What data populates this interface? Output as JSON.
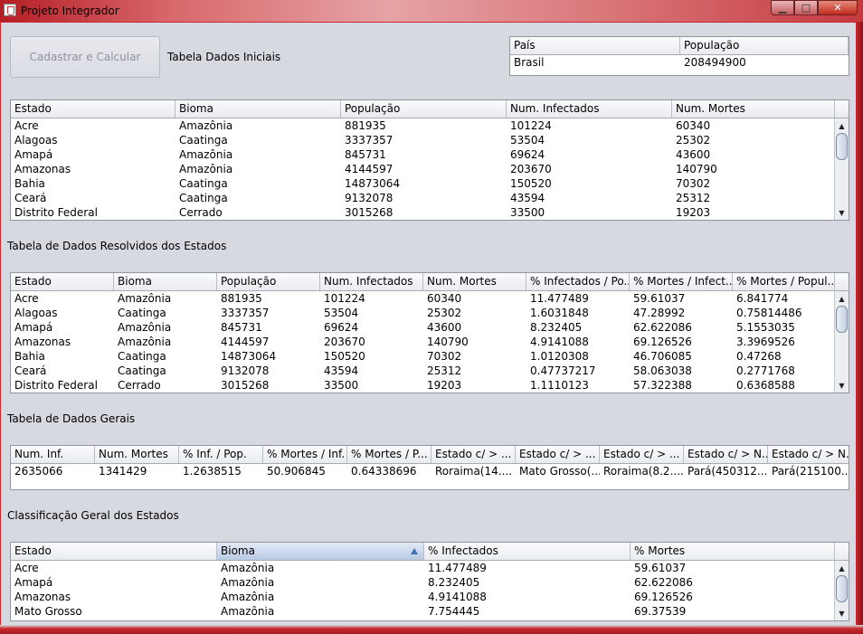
{
  "window": {
    "title": "Projeto Integrador",
    "minimize": "▁",
    "maximize": "□",
    "close": "✕"
  },
  "toolbar": {
    "cadastrar_label": "Cadastrar e Calcular",
    "tabela_iniciais_label": "Tabela Dados Iniciais"
  },
  "pais_table": {
    "headers": [
      "País",
      "População"
    ],
    "rows": [
      [
        "Brasil",
        "208494900"
      ]
    ]
  },
  "dados_iniciais": {
    "headers": [
      "Estado",
      "Bioma",
      "População",
      "Num. Infectados",
      "Num. Mortes"
    ],
    "rows": [
      [
        "Acre",
        "Amazônia",
        "881935",
        "101224",
        "60340"
      ],
      [
        "Alagoas",
        "Caatinga",
        "3337357",
        "53504",
        "25302"
      ],
      [
        "Amapá",
        "Amazônia",
        "845731",
        "69624",
        "43600"
      ],
      [
        "Amazonas",
        "Amazônia",
        "4144597",
        "203670",
        "140790"
      ],
      [
        "Bahia",
        "Caatinga",
        "14873064",
        "150520",
        "70302"
      ],
      [
        "Ceará",
        "Caatinga",
        "9132078",
        "43594",
        "25312"
      ],
      [
        "Distrito Federal",
        "Cerrado",
        "3015268",
        "33500",
        "19203"
      ]
    ]
  },
  "resolvidos": {
    "title": "Tabela de Dados Resolvidos dos Estados",
    "headers": [
      "Estado",
      "Bioma",
      "População",
      "Num. Infectados",
      "Num. Mortes",
      "% Infectados / Po...",
      "% Mortes / Infect...",
      "% Mortes / Popul..."
    ],
    "rows": [
      [
        "Acre",
        "Amazônia",
        "881935",
        "101224",
        "60340",
        "11.477489",
        "59.61037",
        "6.841774"
      ],
      [
        "Alagoas",
        "Caatinga",
        "3337357",
        "53504",
        "25302",
        "1.6031848",
        "47.28992",
        "0.75814486"
      ],
      [
        "Amapá",
        "Amazônia",
        "845731",
        "69624",
        "43600",
        "8.232405",
        "62.622086",
        "5.1553035"
      ],
      [
        "Amazonas",
        "Amazônia",
        "4144597",
        "203670",
        "140790",
        "4.9141088",
        "69.126526",
        "3.3969526"
      ],
      [
        "Bahia",
        "Caatinga",
        "14873064",
        "150520",
        "70302",
        "1.0120308",
        "46.706085",
        "0.47268"
      ],
      [
        "Ceará",
        "Caatinga",
        "9132078",
        "43594",
        "25312",
        "0.47737217",
        "58.063038",
        "0.2771768"
      ],
      [
        "Distrito Federal",
        "Cerrado",
        "3015268",
        "33500",
        "19203",
        "1.1110123",
        "57.322388",
        "0.6368588"
      ]
    ]
  },
  "gerais": {
    "title": "Tabela de Dados Gerais",
    "headers": [
      "Num. Inf.",
      "Num. Mortes",
      "% Inf. / Pop.",
      "% Mortes / Inf.",
      "% Mortes / P...",
      "Estado c/ > ...",
      "Estado c/ > ...",
      "Estado c/ > ...",
      "Estado c/ > N...",
      "Estado c/ > N..."
    ],
    "rows": [
      [
        "2635066",
        "1341429",
        "1.2638515",
        "50.906845",
        "0.64338696",
        "Roraima(14....",
        "Mato Grosso(...",
        "Roraima(8.2....",
        "Pará(450312...",
        "Pará(215100..."
      ]
    ]
  },
  "classificacao": {
    "title": "Classificação Geral dos Estados",
    "headers": [
      "Estado",
      "Bioma",
      "% Infectados",
      "% Mortes"
    ],
    "sorted_column": "Bioma",
    "rows": [
      [
        "Acre",
        "Amazônia",
        "11.477489",
        "59.61037"
      ],
      [
        "Amapá",
        "Amazônia",
        "8.232405",
        "62.622086"
      ],
      [
        "Amazonas",
        "Amazônia",
        "4.9141088",
        "69.126526"
      ],
      [
        "Mato Grosso",
        "Amazônia",
        "7.754445",
        "69.37539"
      ]
    ]
  }
}
